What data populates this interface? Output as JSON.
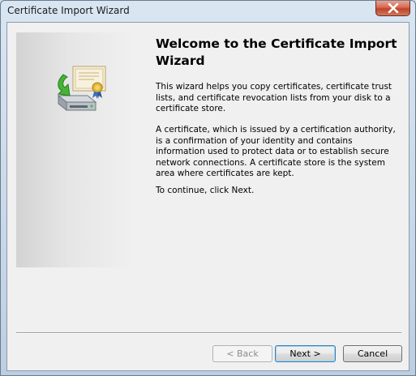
{
  "window": {
    "title": "Certificate Import Wizard"
  },
  "content": {
    "heading": "Welcome to the Certificate Import Wizard",
    "paragraph1": "This wizard helps you copy certificates, certificate trust lists, and certificate revocation lists from your disk to a certificate store.",
    "paragraph2": "A certificate, which is issued by a certification authority, is a confirmation of your identity and contains information used to protect data or to establish secure network connections. A certificate store is the system area where certificates are kept.",
    "paragraph3": "To continue, click Next."
  },
  "buttons": {
    "back_label": "< Back",
    "next_label": "Next >",
    "cancel_label": "Cancel"
  },
  "icons": {
    "close": "close-icon",
    "illustration": "certificate-import-icon"
  }
}
